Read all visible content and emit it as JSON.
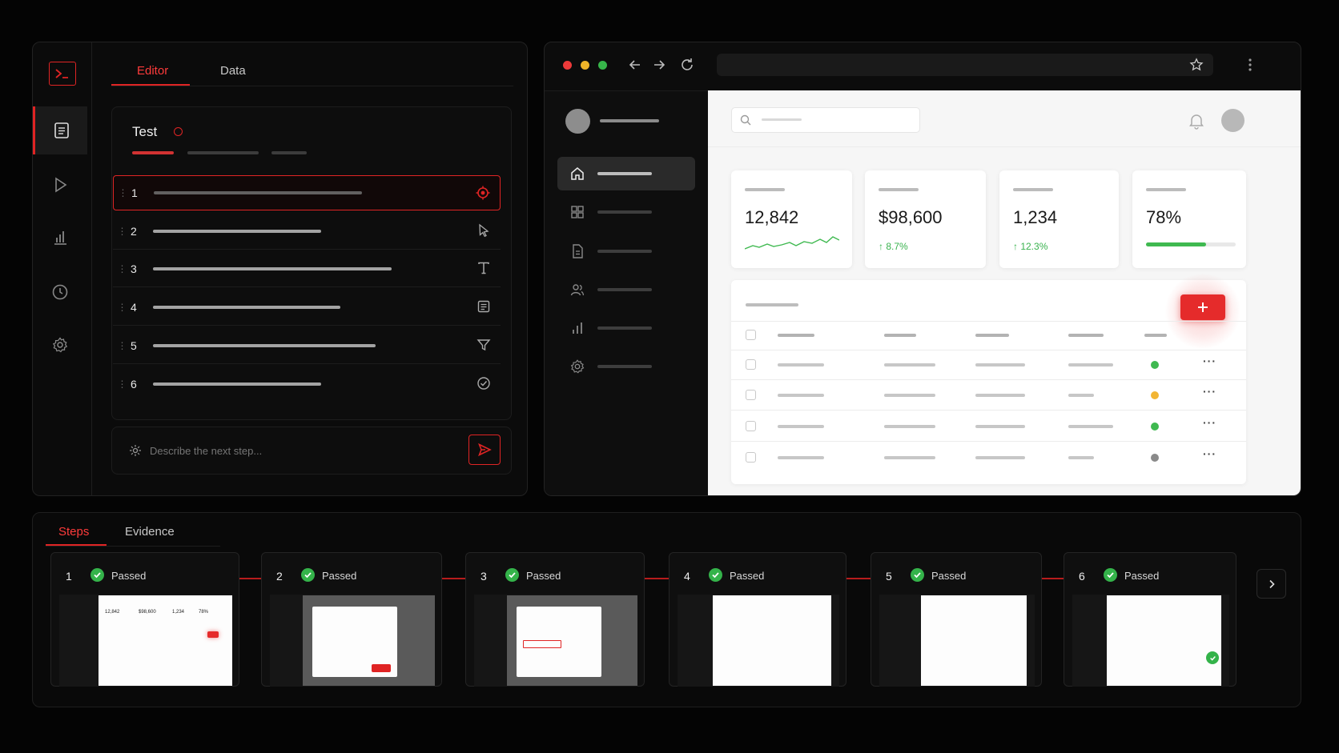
{
  "editor": {
    "tabs": [
      "Editor",
      "Data"
    ],
    "active_tab": "Editor",
    "test_title": "Test",
    "steps": [
      {
        "num": "1",
        "icon": "target-icon",
        "selected": true
      },
      {
        "num": "2",
        "icon": "cursor-icon"
      },
      {
        "num": "3",
        "icon": "text-icon"
      },
      {
        "num": "4",
        "icon": "form-icon"
      },
      {
        "num": "5",
        "icon": "filter-icon"
      },
      {
        "num": "6",
        "icon": "check-circle-icon"
      }
    ],
    "prompt_placeholder": "Describe the next step..."
  },
  "sidebar_icons": [
    "terminal-icon",
    "document-icon",
    "play-icon",
    "bar-chart-icon",
    "clock-icon",
    "settings-icon"
  ],
  "dashboard": {
    "metrics": [
      {
        "value": "12,842"
      },
      {
        "value": "$98,600",
        "delta": "↑ 8.7%"
      },
      {
        "value": "1,234",
        "delta": "↑ 12.3%"
      },
      {
        "value": "78%",
        "progress": 0.67
      }
    ],
    "row_status_colors": [
      "#3fb950",
      "#f2b533",
      "#3fb950",
      "#8a8a8a"
    ]
  },
  "bottom": {
    "tabs": [
      "Steps",
      "Evidence"
    ],
    "active_tab": "Steps",
    "steps": [
      {
        "num": "1",
        "status": "Passed"
      },
      {
        "num": "2",
        "status": "Passed"
      },
      {
        "num": "3",
        "status": "Passed"
      },
      {
        "num": "4",
        "status": "Passed"
      },
      {
        "num": "5",
        "status": "Passed"
      },
      {
        "num": "6",
        "status": "Passed"
      }
    ]
  },
  "colors": {
    "accent": "#e02424",
    "success": "#34b34a",
    "warning": "#f2b533"
  }
}
